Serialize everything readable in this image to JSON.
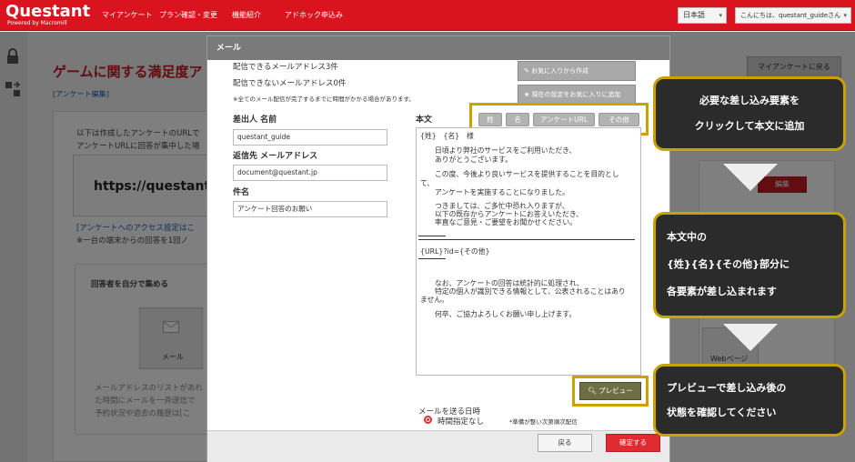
{
  "app": {
    "logo": "Questant",
    "logo_sub": "Powered by Macromill"
  },
  "nav": [
    "マイアンケート",
    "プラン確認・変更",
    "機能紹介",
    "アドホック申込み"
  ],
  "header": {
    "language": "日本語",
    "greeting": "こんにちは、questant_guideさん"
  },
  "background": {
    "page_title": "ゲームに関する満足度ア",
    "edit_link": "[アンケート編集]",
    "desc_1": "以下は作成したアンケートのURLで",
    "desc_2": "アンケートURLに回答が集中した場",
    "url": "https://questant.j",
    "access_link": "[アンケートへのアクセス設定はこ",
    "note_one_device": "※一台の端末からの回答を1回ノ",
    "collect_heading": "回答者を自分で集める",
    "mail_label": "メール",
    "mail_desc_1": "メールアドレスのリストがあれ",
    "mail_desc_2": "た時間にメールを一斉送信で",
    "mail_desc_3": "予約状況や過去の履歴は[こ",
    "my_survey_back": "マイアンケートに戻る",
    "edit_button": "編集",
    "web_page": "Webページ"
  },
  "modal": {
    "title": "メール",
    "deliverable": "配信できるメールアドレス3件",
    "undeliverable": "配信できないメールアドレス0件",
    "note_delay": "※全てのメール配信が完了するまでに時間がかかる場合があります。",
    "btn_create_from_favorite": "お気に入りから作成",
    "btn_save_favorite": "現在の設定をお気に入りに追加",
    "sender_name_label": "差出人 名前",
    "sender_name_value": "questant_guide",
    "reply_email_label": "返信先 メールアドレス",
    "reply_email_value": "document@questant.jp",
    "subject_label": "件名",
    "subject_value": "アンケート回答のお願い",
    "body_label": "本文",
    "tags": [
      "姓",
      "名",
      "アンケートURL",
      "その他"
    ],
    "body_lines": [
      "{姓}　{名}　様",
      "日頃より弊社のサービスをご利用いただき、",
      "ありがとうございます。",
      "この度、今後より良いサービスを提供することを目的とし",
      "て、",
      "アンケートを実施することになりました。",
      "つきましては、ご多忙中恐れ入りますが、",
      "以下の既存からアンケートにお答えいただき、",
      "率直なご意見・ご要望をお聞かせください。",
      "{URL}?id={その他}",
      "なお、アンケートの回答は統計的に処理され、",
      "特定の個人が識別できる情報として、公表されることはあり",
      "ません。",
      "何卒、ご協力よろしくお願い申し上げます。"
    ],
    "preview_button": "プレビュー",
    "send_time_label": "メールを送る日時",
    "send_time_option": "時間指定なし",
    "send_time_note": "*準備が整い次第順次配信",
    "back_button": "戻る",
    "confirm_button": "確定する"
  },
  "callouts": {
    "c1_line1": "必要な差し込み要素を",
    "c1_line2": "クリックして本文に追加",
    "c2_line1": "本文中の",
    "c2_line2": "{姓}{名}{その他}部分に",
    "c2_line3": "各要素が差し込まれます",
    "c3_line1": "プレビューで差し込み後の",
    "c3_line2": "状態を確認してください"
  }
}
